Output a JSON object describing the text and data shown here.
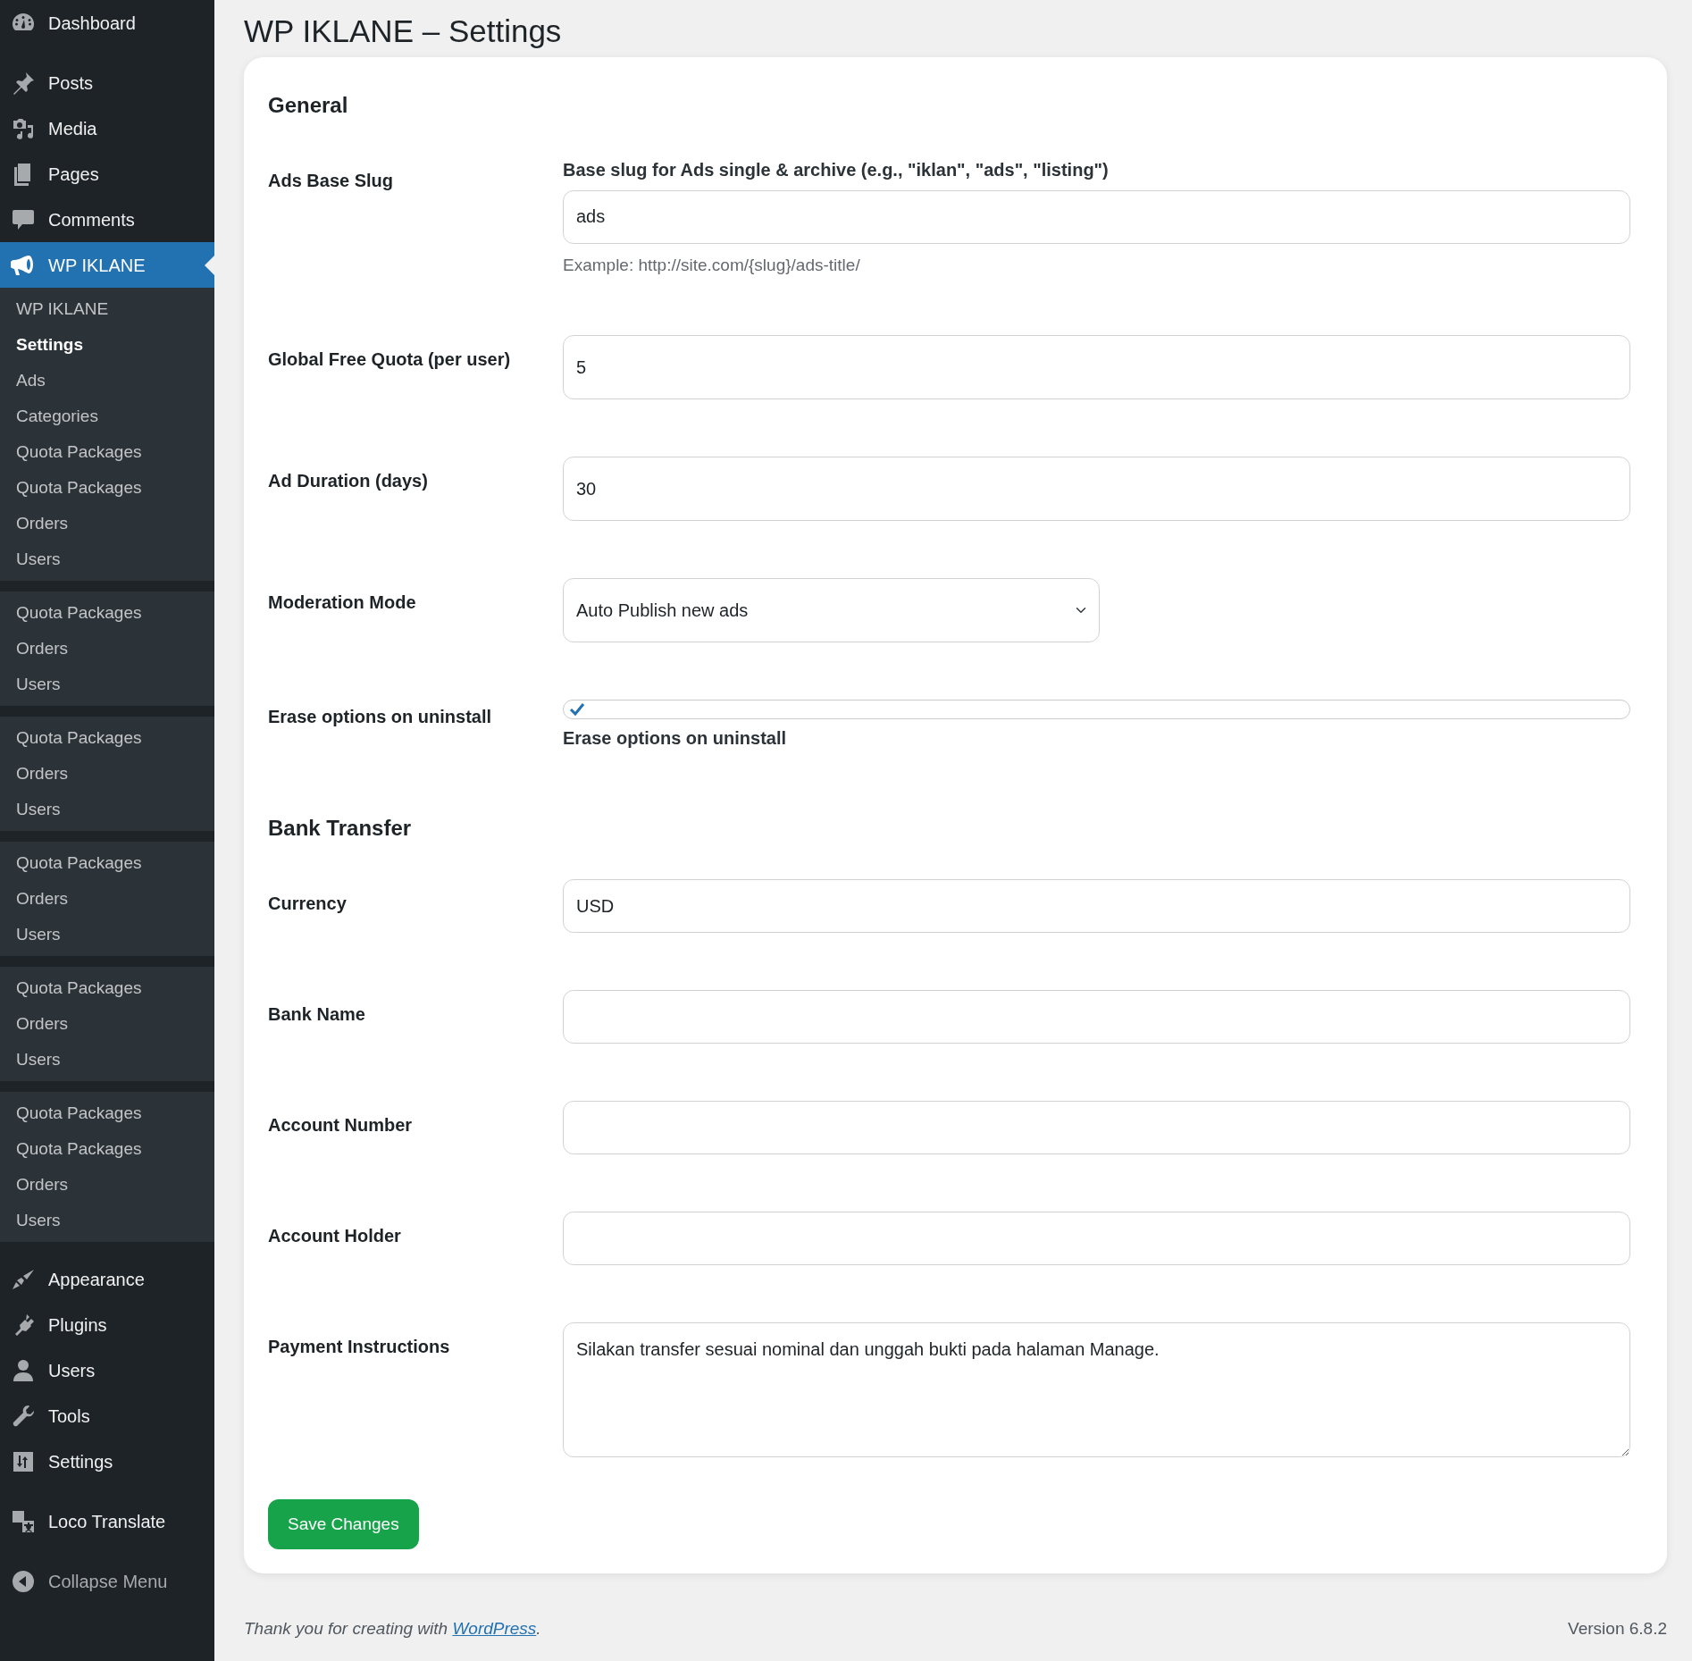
{
  "sidebar": {
    "sections": [
      [
        {
          "label": "Dashboard",
          "selected": false
        }
      ],
      [
        {
          "label": "Posts",
          "selected": false
        },
        {
          "label": "Media",
          "selected": false
        },
        {
          "label": "Pages",
          "selected": false
        },
        {
          "label": "Comments",
          "selected": false
        },
        {
          "label": "WP IKLANE",
          "selected": true,
          "submenu_groups": [
            [
              {
                "label": "WP IKLANE",
                "selected": false
              },
              {
                "label": "Settings",
                "selected": true
              },
              {
                "label": "Ads",
                "selected": false
              },
              {
                "label": "Categories",
                "selected": false
              },
              {
                "label": "Quota Packages",
                "selected": false
              },
              {
                "label": "Quota Packages",
                "selected": false
              },
              {
                "label": "Orders",
                "selected": false
              },
              {
                "label": "Users",
                "selected": false
              }
            ],
            [
              {
                "label": "Quota Packages",
                "selected": false
              },
              {
                "label": "Orders",
                "selected": false
              },
              {
                "label": "Users",
                "selected": false
              }
            ],
            [
              {
                "label": "Quota Packages",
                "selected": false
              },
              {
                "label": "Orders",
                "selected": false
              },
              {
                "label": "Users",
                "selected": false
              }
            ],
            [
              {
                "label": "Quota Packages",
                "selected": false
              },
              {
                "label": "Orders",
                "selected": false
              },
              {
                "label": "Users",
                "selected": false
              }
            ],
            [
              {
                "label": "Quota Packages",
                "selected": false
              },
              {
                "label": "Orders",
                "selected": false
              },
              {
                "label": "Users",
                "selected": false
              }
            ],
            [
              {
                "label": "Quota Packages",
                "selected": false
              },
              {
                "label": "Quota Packages",
                "selected": false
              },
              {
                "label": "Orders",
                "selected": false
              },
              {
                "label": "Users",
                "selected": false
              }
            ]
          ]
        }
      ],
      [
        {
          "label": "Appearance",
          "selected": false
        },
        {
          "label": "Plugins",
          "selected": false
        },
        {
          "label": "Users",
          "selected": false
        },
        {
          "label": "Tools",
          "selected": false
        },
        {
          "label": "Settings",
          "selected": false
        }
      ],
      [
        {
          "label": "Loco Translate",
          "selected": false
        }
      ]
    ],
    "collapse": "Collapse Menu"
  },
  "page_title": "WP IKLANE – Settings",
  "sections": [
    {
      "heading": "General",
      "fields": [
        {
          "kind": "text",
          "label": "Ads Base Slug",
          "caption": "Base slug for Ads single & archive (e.g., \"iklan\", \"ads\", \"listing\")",
          "value": "ads",
          "hint": "Example: http://site.com/{slug}/ads-title/"
        },
        {
          "kind": "number",
          "label": "Global Free Quota (per user)",
          "value": "5"
        },
        {
          "kind": "number",
          "label": "Ad Duration (days)",
          "value": "30"
        },
        {
          "kind": "select",
          "label": "Moderation Mode",
          "value": "Auto Publish new ads"
        },
        {
          "kind": "checkbox",
          "label": "Erase options on uninstall",
          "checked": true,
          "caption": "Erase options on uninstall"
        }
      ]
    },
    {
      "heading": "Bank Transfer",
      "fields": [
        {
          "kind": "text",
          "label": "Currency",
          "value": "USD"
        },
        {
          "kind": "text",
          "label": "Bank Name"
        },
        {
          "kind": "text",
          "label": "Account Number"
        },
        {
          "kind": "text",
          "label": "Account Holder"
        },
        {
          "kind": "textarea",
          "label": "Payment Instructions",
          "value": "Silakan transfer sesuai nominal dan unggah bukti pada halaman Manage."
        }
      ]
    }
  ],
  "save_button": "Save Changes",
  "footer": {
    "credit": "Thank you for creating with",
    "link": "WordPress",
    "after": ".",
    "version": "Version 6.8.2"
  }
}
